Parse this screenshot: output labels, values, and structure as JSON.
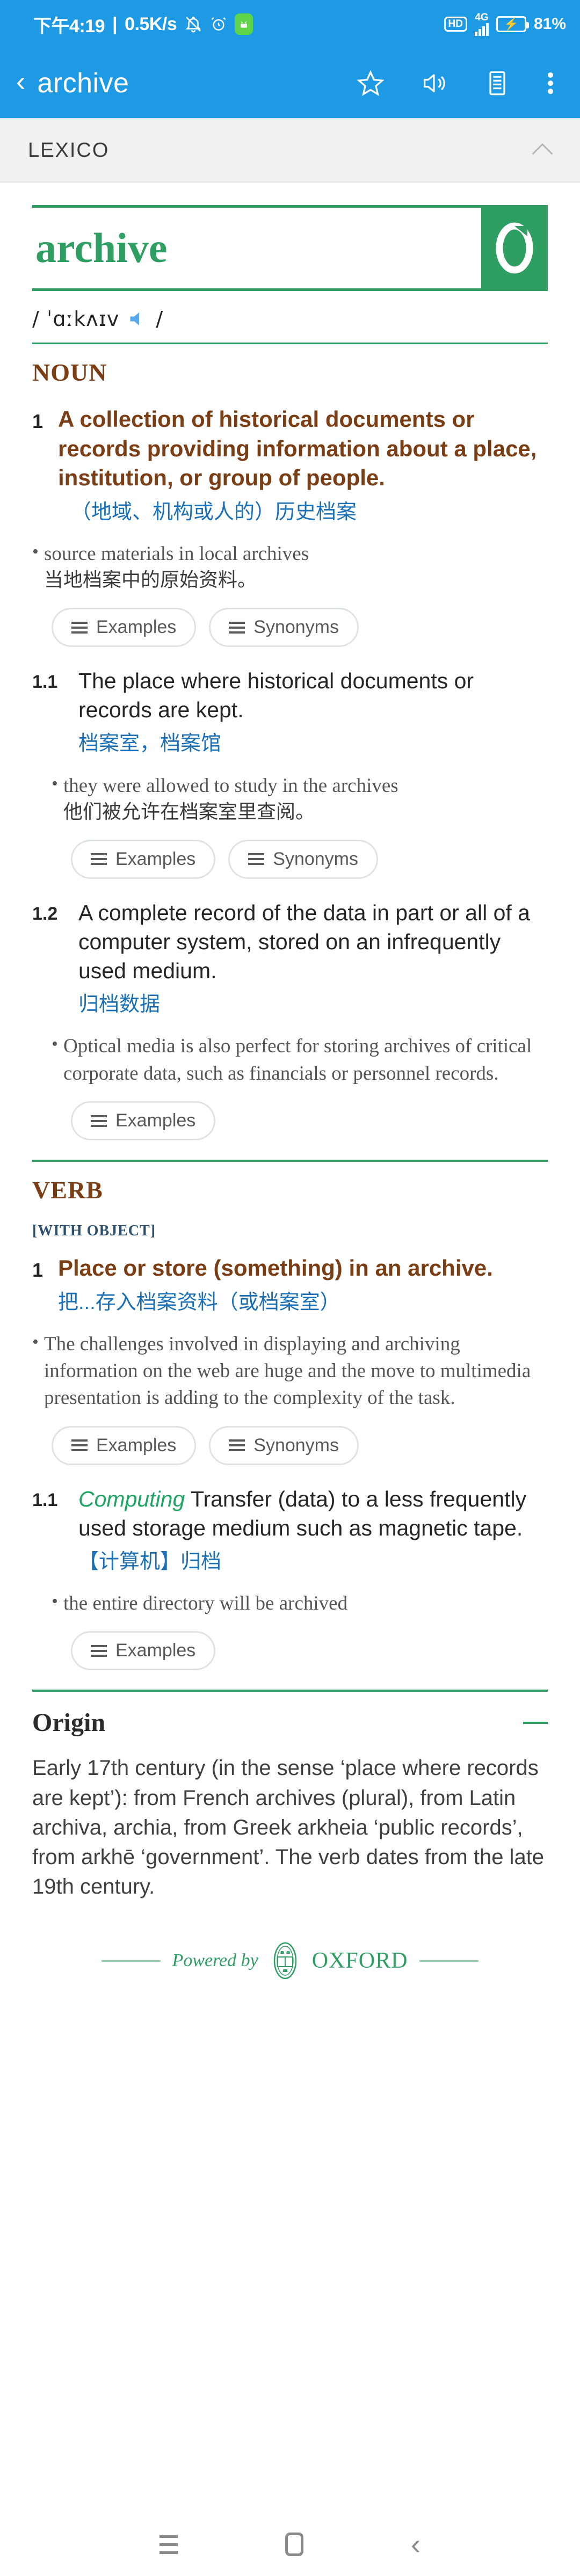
{
  "status_bar": {
    "time": "下午4:19",
    "separator": "|",
    "net_speed": "0.5K/s",
    "icons": [
      "mute-bell-icon",
      "alarm-clock-icon",
      "android-app-icon"
    ],
    "hd_label": "HD",
    "network_type": "4G",
    "battery_pct": "81%",
    "accent_color": "#1e9ae4"
  },
  "app_bar": {
    "back_label": "‹",
    "title": "archive",
    "actions": [
      "star-icon",
      "speaker-icon",
      "list-icon",
      "overflow-menu-icon"
    ]
  },
  "source_bar": {
    "label": "LEXICO",
    "collapse_icon": "chevron-up-icon"
  },
  "entry": {
    "headword": "archive",
    "logo_letter": "O",
    "pronunciation": "/ ˈɑːkʌɪv",
    "pronunciation_close": "/",
    "headword_color": "#2e9e63"
  },
  "noun": {
    "pos_label": "NOUN",
    "senses": [
      {
        "num": "1",
        "definition": "A collection of historical documents or records providing information about a place, institution, or group of people.",
        "translation": "（地域、机构或人的）历史档案",
        "example_en": "source materials in local archives",
        "example_zh": "当地档案中的原始资料。",
        "buttons": [
          "Examples",
          "Synonyms"
        ]
      },
      {
        "num": "1.1",
        "definition": "The place where historical documents or records are kept.",
        "translation": "档案室，档案馆",
        "example_en": "they were allowed to study in the archives",
        "example_zh": "他们被允许在档案室里查阅。",
        "buttons": [
          "Examples",
          "Synonyms"
        ]
      },
      {
        "num": "1.2",
        "definition": "A complete record of the data in part or all of a computer system, stored on an infrequently used medium.",
        "translation": "归档数据",
        "example_en": "Optical media is also perfect for storing archives of critical corporate data, such as financials or personnel records.",
        "example_zh": "",
        "buttons": [
          "Examples"
        ]
      }
    ]
  },
  "verb": {
    "pos_label": "VERB",
    "grammar_label": "[WITH OBJECT]",
    "senses": [
      {
        "num": "1",
        "domain": "",
        "definition": "Place or store (something) in an archive.",
        "translation": "把...存入档案资料（或档案室）",
        "example_en": "The challenges involved in displaying and archiving information on the web are huge and the move to multimedia presentation is adding to the complexity of the task.",
        "example_zh": "",
        "buttons": [
          "Examples",
          "Synonyms"
        ]
      },
      {
        "num": "1.1",
        "domain": "Computing",
        "definition": "Transfer (data) to a less frequently used storage medium such as magnetic tape.",
        "translation": "【计算机】归档",
        "example_en": "the entire directory will be archived",
        "example_zh": "",
        "buttons": [
          "Examples"
        ]
      }
    ]
  },
  "origin": {
    "title": "Origin",
    "collapse_icon": "minus-icon",
    "text": "Early 17th century (in the sense ‘place where records are kept’): from French archives (plural), from Latin archiva, archia, from Greek arkheia ‘public records’, from arkhē ‘government’. The verb dates from the late 19th century."
  },
  "footer": {
    "powered_by": "Powered by",
    "brand": "OXFORD",
    "crest_icon": "oxford-crest-icon"
  },
  "nav_bar": {
    "recents": "recents-icon",
    "home": "home-icon",
    "back": "back-icon"
  }
}
